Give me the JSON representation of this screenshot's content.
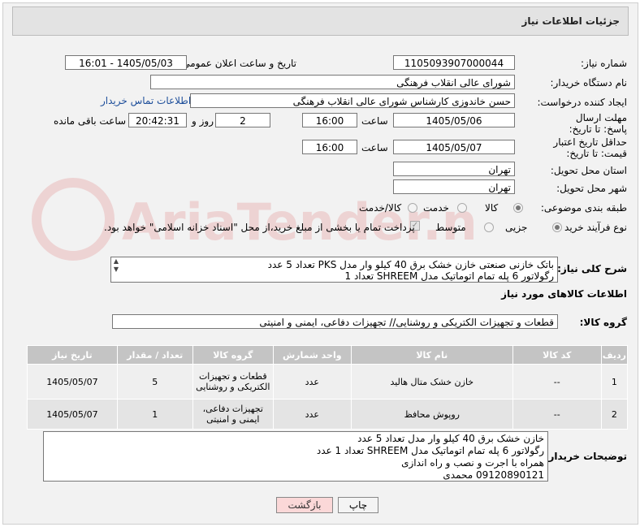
{
  "header": {
    "title": "جزئیات اطلاعات نیاز"
  },
  "fields": {
    "need_number": {
      "label": "شماره نیاز:",
      "value": "1105093907000044"
    },
    "announce": {
      "label": "تاریخ و ساعت اعلان عمومی:",
      "value": "1405/05/03 - 16:01"
    },
    "buyer": {
      "label": "نام دستگاه خریدار:",
      "value": "شورای عالی انقلاب فرهنگی"
    },
    "creator": {
      "label": "ایجاد کننده درخواست:",
      "value": "حسن خاندوزی کارشناس شورای عالی انقلاب فرهنگی",
      "contact_link": "اطلاعات تماس خریدار"
    },
    "reply_deadline": {
      "label": "مهلت ارسال پاسخ: تا تاریخ:",
      "date": "1405/05/06",
      "time_label": "ساعت",
      "time": "16:00",
      "days": "2",
      "days_label": "روز و",
      "remaining": "20:42:31",
      "remaining_label": "ساعت باقی مانده"
    },
    "price_validity": {
      "label": "حداقل تاریخ اعتبار قیمت: تا تاریخ:",
      "date": "1405/05/07",
      "time_label": "ساعت",
      "time": "16:00"
    },
    "province": {
      "label": "استان محل تحویل:",
      "value": "تهران"
    },
    "city": {
      "label": "شهر محل تحویل:",
      "value": "تهران"
    },
    "category": {
      "label": "طبقه بندی موضوعی:",
      "options": [
        "کالا",
        "خدمت",
        "کالا/خدمت"
      ],
      "selected": "کالا"
    },
    "process": {
      "label": "نوع فرآیند خرید :",
      "options": [
        "جزیی",
        "متوسط"
      ],
      "selected": "جزیی",
      "payment_note": "پرداخت تمام یا بخشی از مبلغ خرید،از محل \"اسناد خزانه اسلامی\" خواهد بود."
    }
  },
  "summary": {
    "label": "شرح کلی نیاز:",
    "lines": [
      "باتک خازنی  صنعتی خازن خشک برق 40 کیلو وار مدل PKS تعداد 5 عدد",
      "رگولاتور 6 پله تمام اتوماتیک  مدل  SHREEM تعداد 1"
    ]
  },
  "goods_info": {
    "title": "اطلاعات کالاهای مورد نیاز",
    "group_label": "گروه کالا:",
    "group_value": "قطعات و تجهیزات الکتریکی و روشنایی// تجهیزات دفاعی، ایمنی و امنیتی"
  },
  "table": {
    "headers": [
      "ردیف",
      "کد کالا",
      "نام کالا",
      "واحد شمارش",
      "گروه کالا",
      "تعداد / مقدار",
      "تاریخ نیاز"
    ],
    "rows": [
      {
        "row": "1",
        "code": "--",
        "name": "خازن خشک متال هالید",
        "unit": "عدد",
        "group": "قطعات و تجهیزات الکتریکی و روشنایی",
        "qty": "5",
        "date": "1405/05/07"
      },
      {
        "row": "2",
        "code": "--",
        "name": "روپوش محافظ",
        "unit": "عدد",
        "group": "تجهیزات دفاعی، ایمنی و امنیتی",
        "qty": "1",
        "date": "1405/05/07"
      }
    ]
  },
  "buyer_notes": {
    "label": "توضیحات خریدار:",
    "lines": [
      "خازن خشک برق 40 کیلو وار مدل تعداد 5 عدد",
      "رگولاتور 6 پله تمام اتوماتیک  مدل  SHREEM تعداد 1 عدد",
      "همراه با اجرت و نصب و راه اندازی",
      "09120890121 محمدی"
    ]
  },
  "buttons": {
    "print": "چاپ",
    "back": "بازگشت"
  },
  "watermark": "AriaTender.net"
}
